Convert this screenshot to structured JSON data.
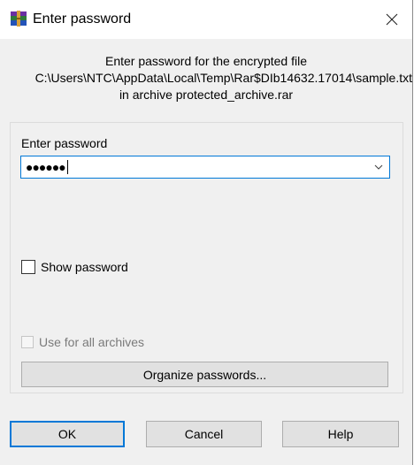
{
  "window": {
    "title": "Enter password",
    "close_glyph": "✕"
  },
  "description": {
    "line1": "Enter password for the encrypted file",
    "line2": "C:\\Users\\NTC\\AppData\\Local\\Temp\\Rar$DIb14632.17014\\sample.txt",
    "line3": "in archive protected_archive.rar"
  },
  "password": {
    "label": "Enter password",
    "value": "●●●●●●"
  },
  "options": {
    "show_password": "Show password",
    "use_for_all": "Use for all archives"
  },
  "buttons": {
    "organize": "Organize passwords...",
    "ok": "OK",
    "cancel": "Cancel",
    "help": "Help"
  },
  "colors": {
    "accent": "#0078d7",
    "dialog_bg": "#f0f0f0",
    "button_bg": "#e1e1e1"
  },
  "icons": {
    "app": "winrar-icon",
    "close": "close-icon",
    "dropdown": "chevron-down-icon"
  }
}
